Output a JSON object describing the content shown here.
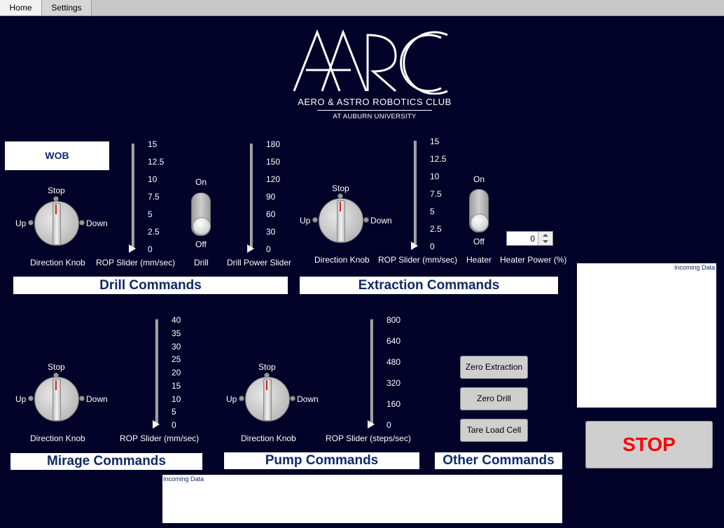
{
  "tabs": [
    {
      "label": "Home"
    },
    {
      "label": "Settings"
    }
  ],
  "logo": {
    "line1": "AERO & ASTRO ROBOTICS CLUB",
    "line2": "AT AUBURN UNIVERSITY"
  },
  "wob": {
    "label": "WOB"
  },
  "knob": {
    "up": "Up",
    "stop": "Stop",
    "down": "Down",
    "caption": "Direction Knob"
  },
  "drill": {
    "rop_caption": "ROP Slider (mm/sec)",
    "rop_ticks": [
      "15",
      "12.5",
      "10",
      "7.5",
      "5",
      "2.5",
      "0"
    ],
    "rop_value": 0,
    "toggle_on": "On",
    "toggle_off": "Off",
    "toggle_caption": "Drill",
    "power_caption": "Drill Power Slider",
    "power_ticks": [
      "180",
      "150",
      "120",
      "90",
      "60",
      "30",
      "0"
    ],
    "power_value": 0,
    "section_title": "Drill Commands"
  },
  "extraction": {
    "rop_caption": "ROP Slider (mm/sec)",
    "rop_ticks": [
      "15",
      "12.5",
      "10",
      "7.5",
      "5",
      "2.5",
      "0"
    ],
    "rop_value": 0,
    "toggle_on": "On",
    "toggle_off": "Off",
    "toggle_caption": "Heater",
    "heater_power_caption": "Heater Power (%)",
    "heater_power_value": "0",
    "section_title": "Extraction Commands"
  },
  "mirage": {
    "rop_caption": "ROP Slider (mm/sec)",
    "rop_ticks": [
      "40",
      "35",
      "30",
      "25",
      "20",
      "15",
      "10",
      "5",
      "0"
    ],
    "rop_value": 0,
    "section_title": "Mirage Commands"
  },
  "pump": {
    "rop_caption": "ROP Slider (steps/sec)",
    "rop_ticks": [
      "800",
      "640",
      "480",
      "320",
      "160",
      "0"
    ],
    "rop_value": 0,
    "section_title": "Pump Commands"
  },
  "other": {
    "zero_extraction": "Zero Extraction",
    "zero_drill": "Zero Drill",
    "tare_load_cell": "Tare Load Cell",
    "section_title": "Other Commands"
  },
  "incoming_right": {
    "label": "Incoming Data"
  },
  "incoming_bottom": {
    "label": "Incoming Data"
  },
  "stop_button": {
    "label": "STOP"
  },
  "colors": {
    "background": "#030228",
    "section_text": "#0e2a6b",
    "stop_text": "#ff0000",
    "needle": "#d02020"
  }
}
